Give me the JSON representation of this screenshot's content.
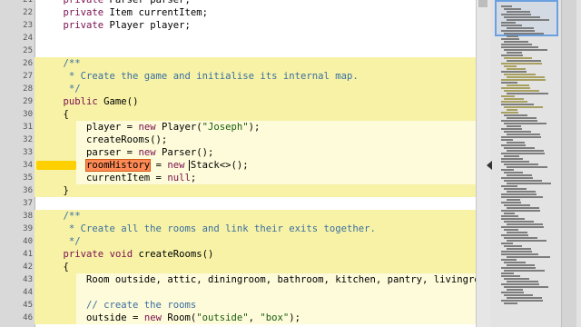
{
  "editor": {
    "lines": [
      {
        "n": "21",
        "bg": "white",
        "text": "    private Parser parser;"
      },
      {
        "n": "22",
        "bg": "white",
        "text": "    private Item currentItem;"
      },
      {
        "n": "23",
        "bg": "white",
        "text": "    private Player player;"
      },
      {
        "n": "24",
        "bg": "white",
        "text": ""
      },
      {
        "n": "25",
        "bg": "white",
        "text": ""
      },
      {
        "n": "26",
        "bg": "yellow",
        "text": "    /**"
      },
      {
        "n": "27",
        "bg": "yellow",
        "text": "     * Create the game and initialise its internal map."
      },
      {
        "n": "28",
        "bg": "yellow",
        "text": "     */"
      },
      {
        "n": "29",
        "bg": "yellow",
        "text": "    public Game()"
      },
      {
        "n": "30",
        "bg": "yellow",
        "text": "    {"
      },
      {
        "n": "31",
        "bg": "nested",
        "text": "        player = new Player(\"Joseph\");"
      },
      {
        "n": "32",
        "bg": "nested",
        "text": "        createRooms();"
      },
      {
        "n": "33",
        "bg": "nested",
        "text": "        parser = new Parser();"
      },
      {
        "n": "34",
        "bg": "nested",
        "text": "        roomHistory = new Stack<>();"
      },
      {
        "n": "35",
        "bg": "nested",
        "text": "        currentItem = null;"
      },
      {
        "n": "36",
        "bg": "yellow",
        "text": "    }"
      },
      {
        "n": "37",
        "bg": "white",
        "text": ""
      },
      {
        "n": "38",
        "bg": "yellow",
        "text": "    /**"
      },
      {
        "n": "39",
        "bg": "yellow",
        "text": "     * Create all the rooms and link their exits together."
      },
      {
        "n": "40",
        "bg": "yellow",
        "text": "     */"
      },
      {
        "n": "41",
        "bg": "yellow",
        "text": "    private void createRooms()"
      },
      {
        "n": "42",
        "bg": "yellow",
        "text": "    {"
      },
      {
        "n": "43",
        "bg": "nested",
        "text": "        Room outside, attic, diningroom, bathroom, kitchen, pantry, livingroom,"
      },
      {
        "n": "44",
        "bg": "nested",
        "text": ""
      },
      {
        "n": "45",
        "bg": "nested",
        "text": "        // create the rooms"
      },
      {
        "n": "46",
        "bg": "nested",
        "text": "        outside = new Room(\"outside\", \"box\");"
      }
    ],
    "highlighted_identifier": "roomHistory"
  },
  "colors": {
    "white": "#ffffff",
    "yellow": "#f7f2a6",
    "nested": "#fdfbd9",
    "keyword": "#7a0f4f",
    "string": "#1a5c10",
    "comment": "#3b6fa0"
  }
}
